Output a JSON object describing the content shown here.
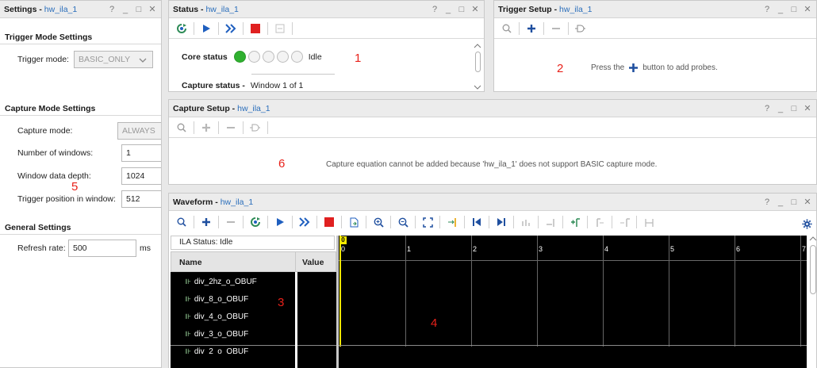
{
  "settings": {
    "title": "Settings",
    "instance": "hw_ila_1",
    "trigger_section": "Trigger Mode Settings",
    "trigger_mode_label": "Trigger mode:",
    "trigger_mode_value": "BASIC_ONLY",
    "capture_section": "Capture Mode Settings",
    "capture_mode_label": "Capture mode:",
    "capture_mode_value": "ALWAYS",
    "num_windows_label": "Number of windows:",
    "num_windows_value": "1",
    "window_depth_label": "Window data depth:",
    "window_depth_value": "1024",
    "trigger_pos_label": "Trigger position in window:",
    "trigger_pos_value": "512",
    "general_section": "General Settings",
    "refresh_label": "Refresh rate:",
    "refresh_value": "500",
    "refresh_unit": "ms"
  },
  "status": {
    "title": "Status",
    "instance": "hw_ila_1",
    "core_status_label": "Core status",
    "core_status_value": "Idle",
    "capture_status_label": "Capture status -",
    "capture_status_value": "Window 1 of 1"
  },
  "trigger_setup": {
    "title": "Trigger Setup",
    "instance": "hw_ila_1",
    "hint_prefix": "Press the",
    "hint_suffix": "button to add probes."
  },
  "capture_setup": {
    "title": "Capture Setup",
    "instance": "hw_ila_1",
    "message": "Capture equation cannot be added because 'hw_ila_1' does not support BASIC capture mode."
  },
  "waveform": {
    "title": "Waveform",
    "instance": "hw_ila_1",
    "ila_status": "ILA Status:  Idle",
    "col_name": "Name",
    "col_value": "Value",
    "signals": [
      "div_2hz_o_OBUF",
      "div_8_o_OBUF",
      "div_4_o_OBUF",
      "div_3_o_OBUF",
      "div_2_o_OBUF"
    ],
    "cursor_label": "0",
    "ticks": [
      "0",
      "1",
      "2",
      "3",
      "4",
      "5",
      "6",
      "7"
    ]
  },
  "annotations": [
    "1",
    "2",
    "3",
    "4",
    "5",
    "6"
  ],
  "window_controls": {
    "help": "?",
    "minimize": "_",
    "maximize": "□",
    "close": "✕"
  },
  "colors": {
    "accent_blue": "#2a6ebb",
    "stop_red": "#e02020",
    "run_blue": "#1f5fbf",
    "status_green": "#2fb02f",
    "annotation_red": "#e8211a",
    "wave_bg": "#000000",
    "cursor_yellow": "#f5e800"
  }
}
